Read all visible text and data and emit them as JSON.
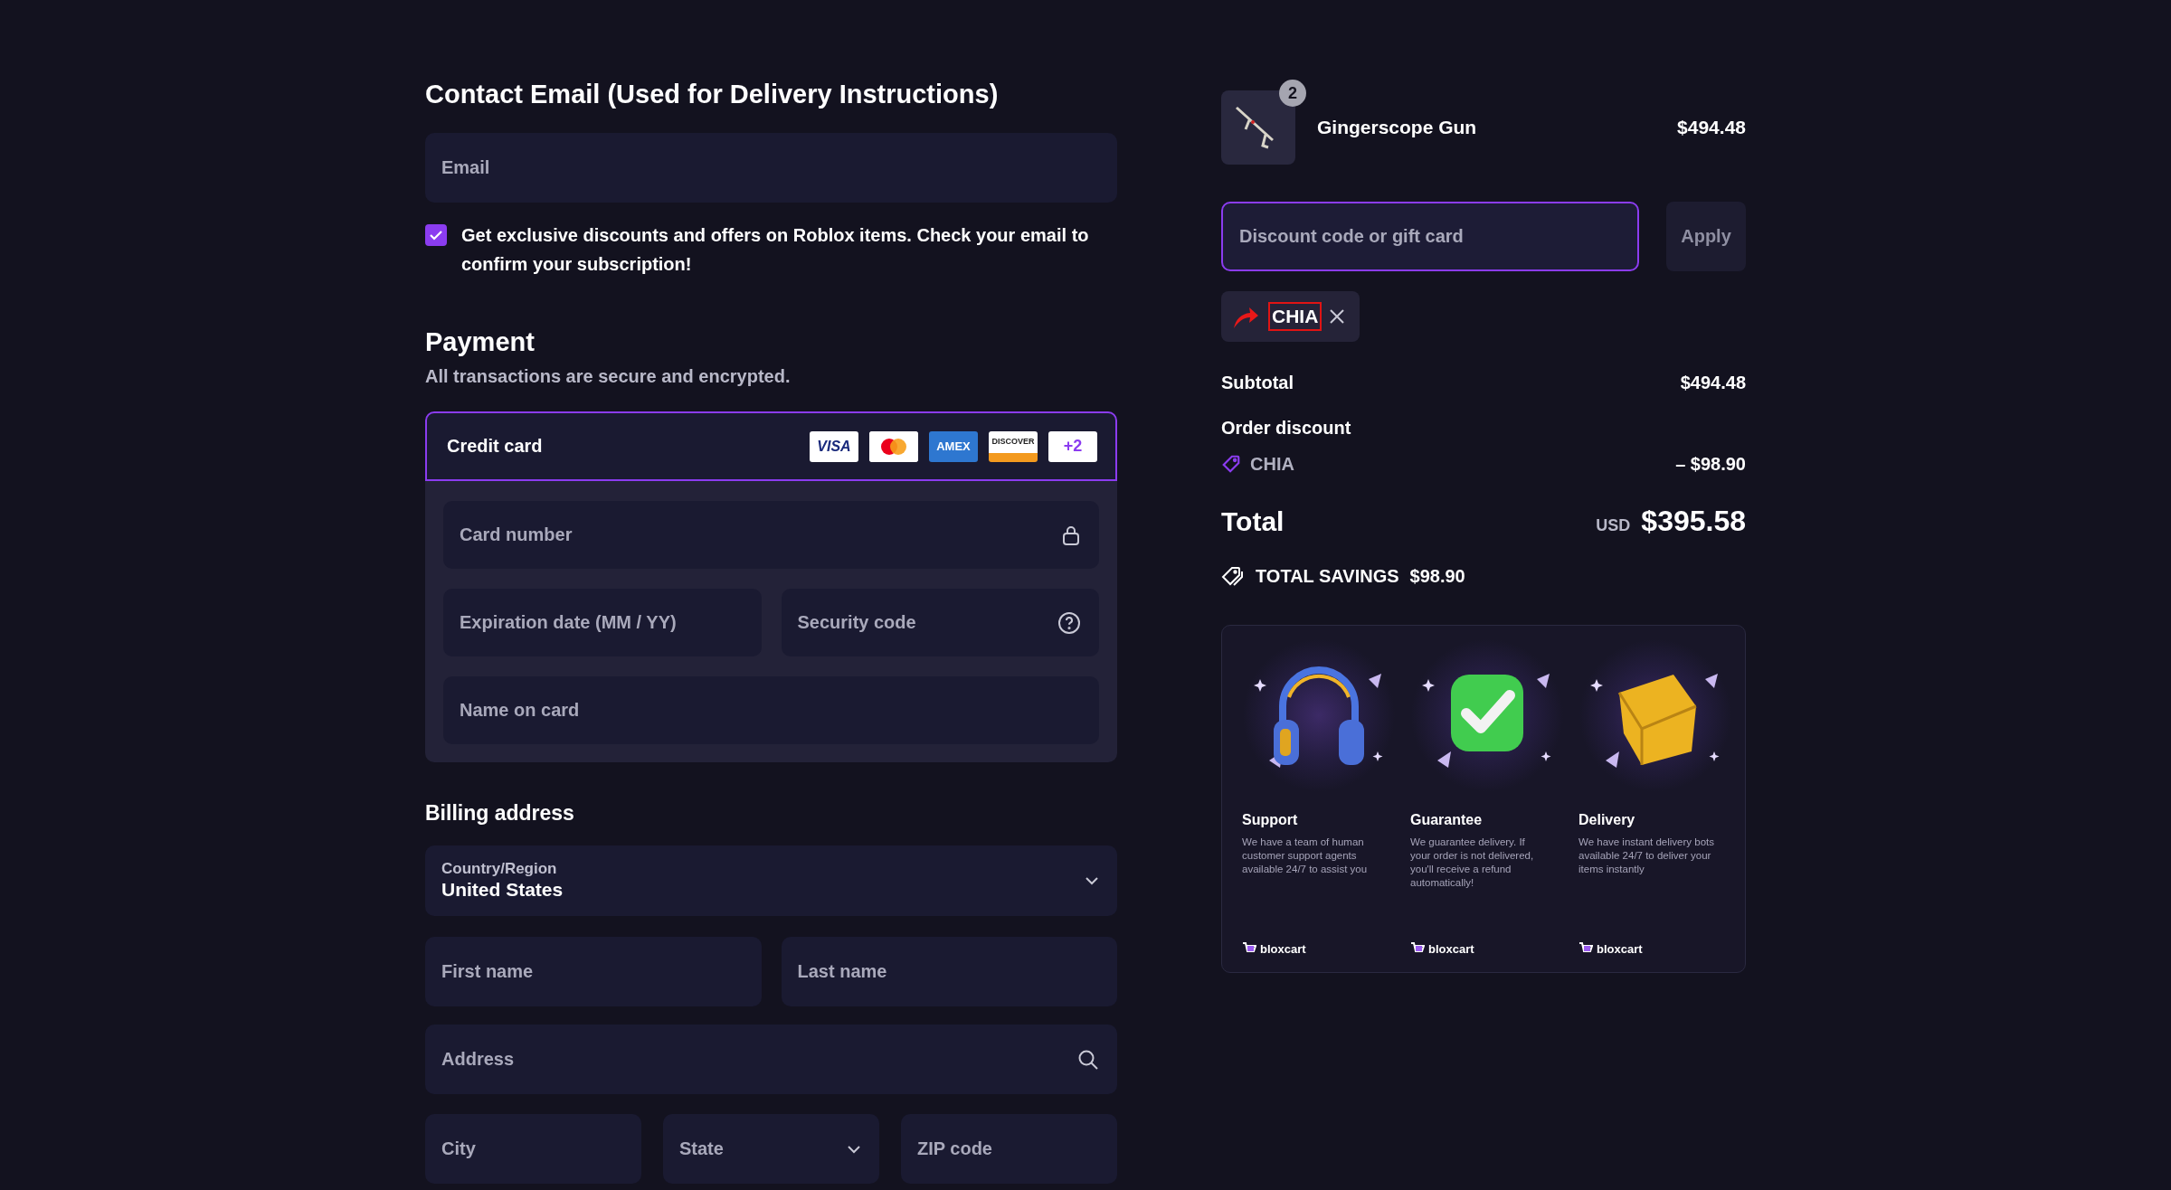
{
  "contact": {
    "heading": "Contact Email (Used for Delivery Instructions)",
    "email": {
      "placeholder": "Email"
    },
    "newsletter": {
      "checked": true,
      "text": "Get exclusive discounts and offers on Roblox items. Check your email to confirm your subscription!"
    }
  },
  "payment": {
    "heading": "Payment",
    "subtitle": "All transactions are secure and encrypted.",
    "method": {
      "label": "Credit card",
      "selected": true
    },
    "card_brands": [
      {
        "kind": "visa",
        "label": "VISA"
      },
      {
        "kind": "mastercard"
      },
      {
        "kind": "amex",
        "label": "AMEX"
      },
      {
        "kind": "discover",
        "label": "DISCOVER"
      },
      {
        "kind": "more",
        "label": "+2"
      }
    ],
    "card_number": {
      "placeholder": "Card number"
    },
    "expiration": {
      "placeholder": "Expiration date (MM / YY)"
    },
    "security_code": {
      "placeholder": "Security code"
    },
    "name_on_card": {
      "placeholder": "Name on card"
    }
  },
  "billing": {
    "heading": "Billing address",
    "country": {
      "label": "Country/Region",
      "value": "United States"
    },
    "first_name": {
      "placeholder": "First name"
    },
    "last_name": {
      "placeholder": "Last name"
    },
    "address": {
      "placeholder": "Address"
    },
    "city": {
      "placeholder": "City"
    },
    "state": {
      "placeholder": "State"
    },
    "zip": {
      "placeholder": "ZIP code"
    }
  },
  "summary": {
    "item": {
      "name": "Gingerscope Gun",
      "quantity": "2",
      "price": "$494.48"
    },
    "discount": {
      "placeholder": "Discount code or gift card",
      "button": "Apply"
    },
    "applied_code": "CHIA",
    "subtotal": {
      "label": "Subtotal",
      "value": "$494.48"
    },
    "order_discount": {
      "label": "Order discount",
      "code": "CHIA",
      "value": "– $98.90"
    },
    "total": {
      "label": "Total",
      "currency": "USD",
      "value": "$395.58"
    },
    "savings": {
      "label": "TOTAL SAVINGS",
      "value": "$98.90"
    }
  },
  "features": [
    {
      "kind": "headphones",
      "title": "Support",
      "text": "We have a team of human customer support agents available 24/7 to assist you",
      "brand": "bloxcart"
    },
    {
      "kind": "check",
      "title": "Guarantee",
      "text": "We guarantee delivery. If your order is not delivered, you'll receive a refund automatically!",
      "brand": "bloxcart"
    },
    {
      "kind": "box",
      "title": "Delivery",
      "text": "We have instant delivery bots available 24/7 to deliver your items instantly",
      "brand": "bloxcart"
    }
  ]
}
